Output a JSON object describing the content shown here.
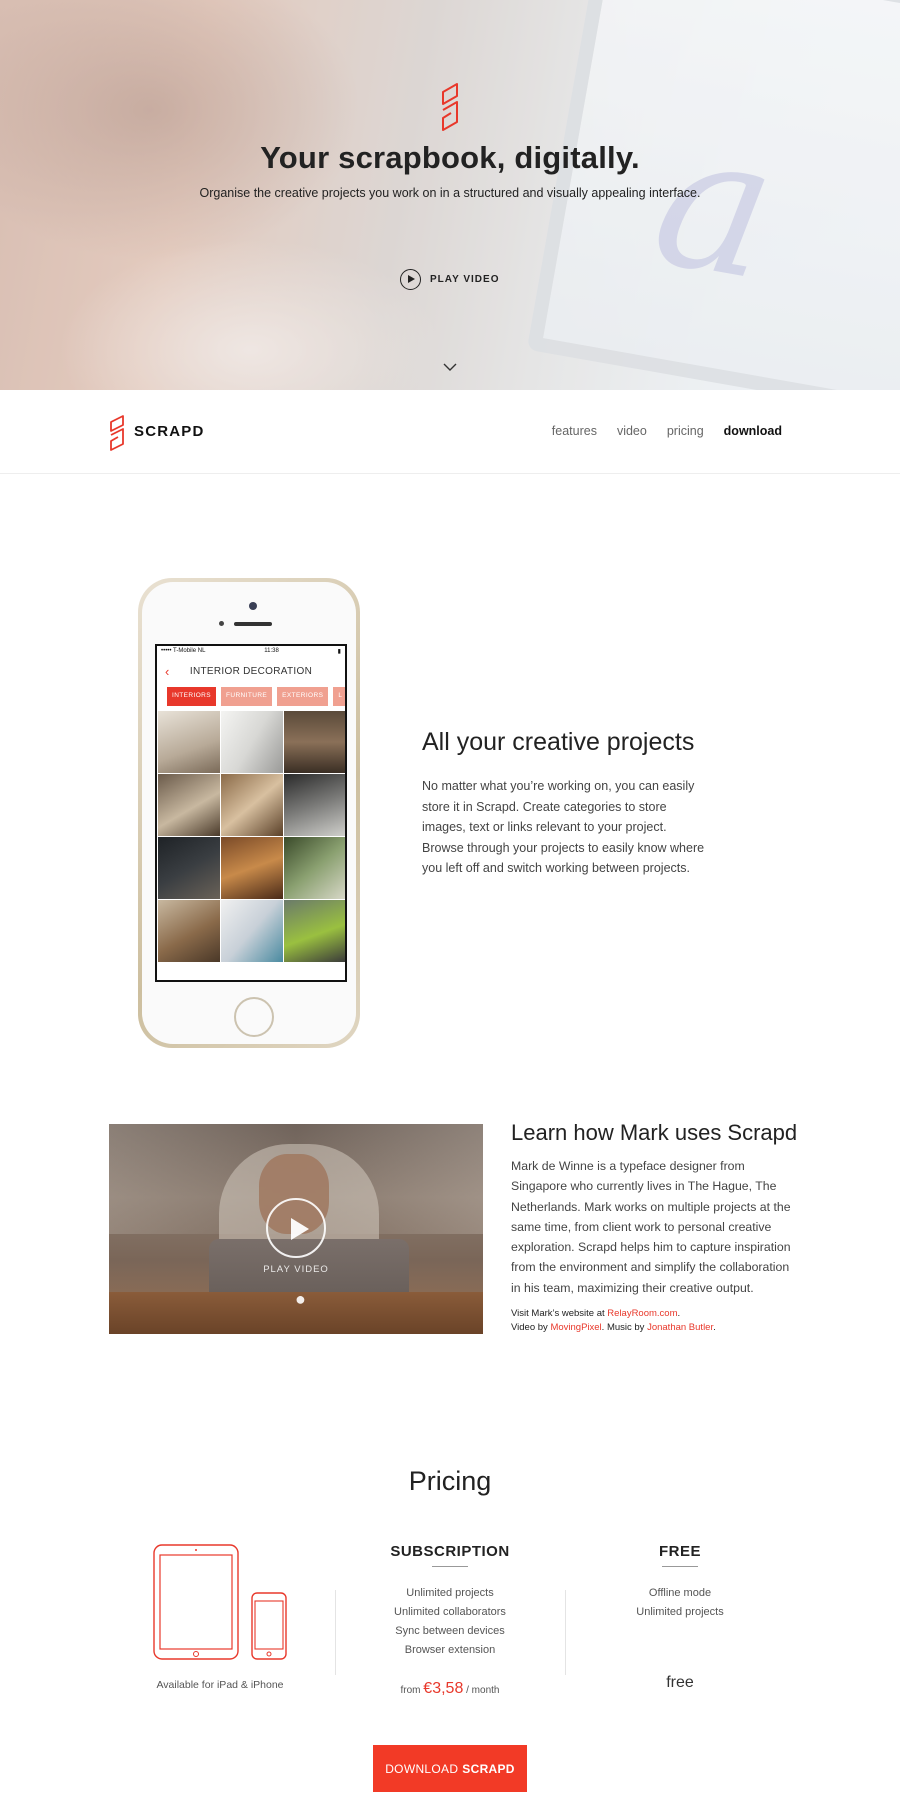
{
  "hero": {
    "title": "Your scrapbook, digitally.",
    "subtitle": "Organise the creative projects you work on in a structured and visually appealing interface.",
    "play_label": "PLAY VIDEO"
  },
  "nav": {
    "brand": "SCRAPD",
    "links": [
      "features",
      "video",
      "pricing",
      "download"
    ],
    "active": "download"
  },
  "phone": {
    "carrier": "••••• T-Mobile NL",
    "time": "11:38",
    "screen_title": "INTERIOR DECORATION",
    "chips": [
      "INTERIORS",
      "FURNITURE",
      "EXTERIORS",
      "L"
    ]
  },
  "feature": {
    "title": "All your creative projects",
    "body": "No matter what you’re working on, you can easily store it in Scrapd. Create categories to store images, text or links relevant to your project. Browse through your projects to easily know where you left off and switch working between projects."
  },
  "video": {
    "play_label": "PLAY VIDEO",
    "title": "Learn how Mark uses Scrapd",
    "body": "Mark de Winne is a typeface designer from Singapore who currently lives in The Hague, The Netherlands. Mark works on multiple projects at the same time, from client work to personal creative exploration. Scrapd helps him to capture inspiration from the environment and simplify the collaboration in his team, maximizing their creative output.",
    "credits": {
      "visit_prefix": "Visit Mark’s website at ",
      "website": "RelayRoom.com",
      "period": ".",
      "video_prefix": "Video by ",
      "video_by": "MovingPixel",
      "music_prefix": ". Music by ",
      "music_by": "Jonathan Butler",
      "end": "."
    }
  },
  "pricing": {
    "title": "Pricing",
    "availability": "Available for iPad & iPhone",
    "subscription": {
      "name": "SUBSCRIPTION",
      "features": [
        "Unlimited projects",
        "Unlimited collaborators",
        "Sync between devices",
        "Browser extension"
      ],
      "from": "from",
      "price": "€3,58",
      "period": "/ month"
    },
    "free": {
      "name": "FREE",
      "features": [
        "Offline mode",
        "Unlimited projects"
      ],
      "price": "free"
    }
  },
  "cta": {
    "prefix": "DOWNLOAD",
    "brand": "SCRAPD"
  },
  "colors": {
    "accent": "#e8382b",
    "button": "#f23a26"
  }
}
